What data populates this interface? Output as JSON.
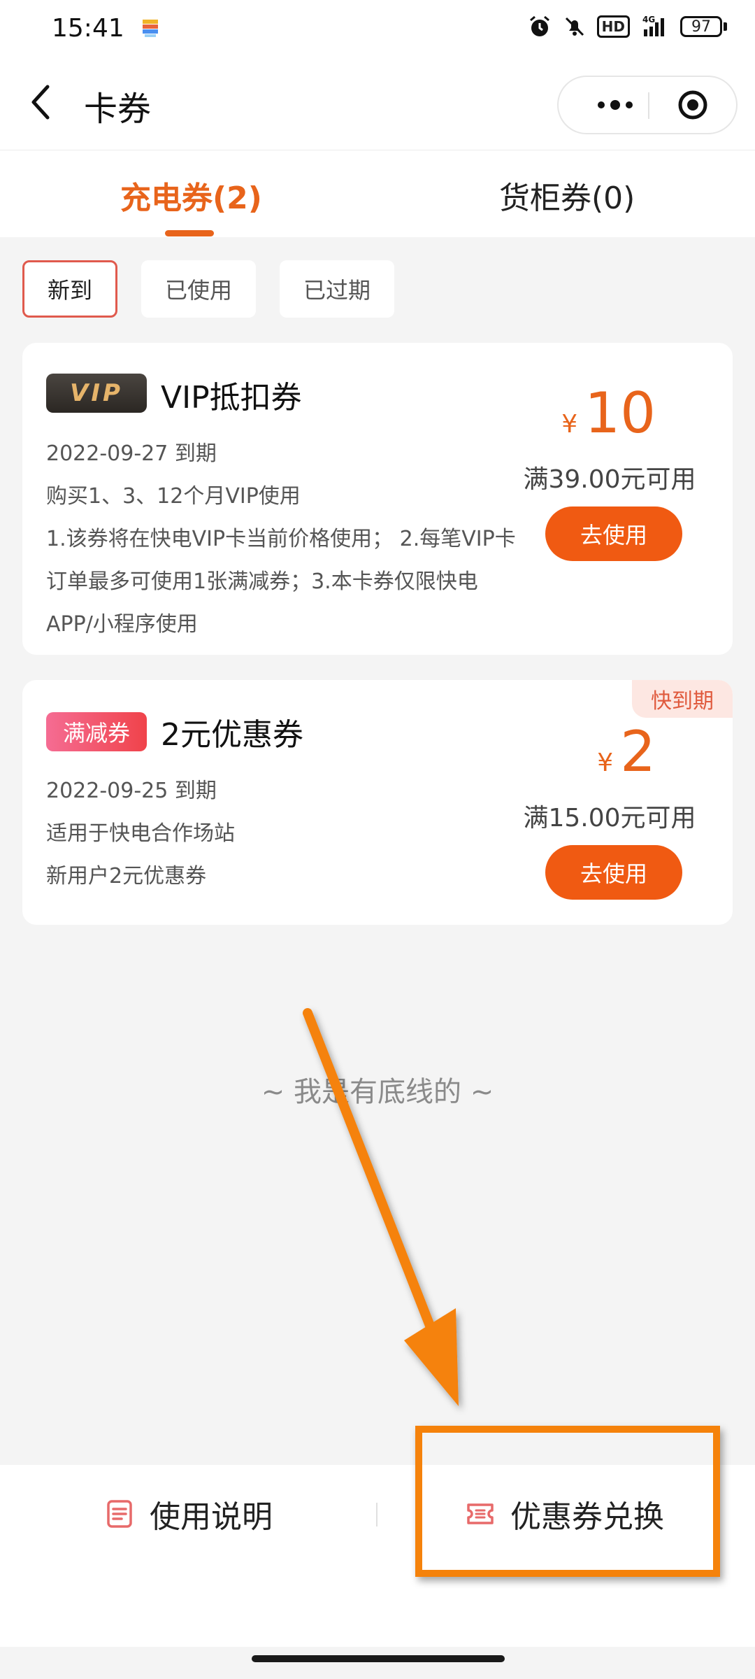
{
  "status_bar": {
    "time": "15:41",
    "hd_label": "HD",
    "network": "4G",
    "battery": "97"
  },
  "nav": {
    "title": "卡券"
  },
  "tabs": [
    {
      "label": "充电券(2)",
      "active": true
    },
    {
      "label": "货柜券(0)",
      "active": false
    }
  ],
  "filters": [
    {
      "label": "新到",
      "active": true
    },
    {
      "label": "已使用",
      "active": false
    },
    {
      "label": "已过期",
      "active": false
    }
  ],
  "coupons": [
    {
      "badge": "VIP",
      "title": "VIP抵扣券",
      "expiry": "2022-09-27 到期",
      "scope": "购买1、3、12个月VIP使用",
      "description": "1.该券将在快电VIP卡当前价格使用； 2.每笔VIP卡订单最多可使用1张满减券；3.本卡券仅限快电APP/小程序使用",
      "currency": "¥",
      "amount": "10",
      "min_spend": "满39.00元可用",
      "button": "去使用"
    },
    {
      "badge": "满减券",
      "title": "2元优惠券",
      "expiry": "2022-09-25 到期",
      "scope": "适用于快电合作场站",
      "description": "新用户2元优惠券",
      "tag": "快到期",
      "currency": "¥",
      "amount": "2",
      "min_spend": "满15.00元可用",
      "button": "去使用"
    }
  ],
  "bottom_text": "~ 我是有底线的 ~",
  "bottom_bar": {
    "usage_label": "使用说明",
    "exchange_label": "优惠券兑换"
  },
  "colors": {
    "accent": "#e8641b",
    "button": "#f05a12",
    "annotation": "#f5820b"
  }
}
